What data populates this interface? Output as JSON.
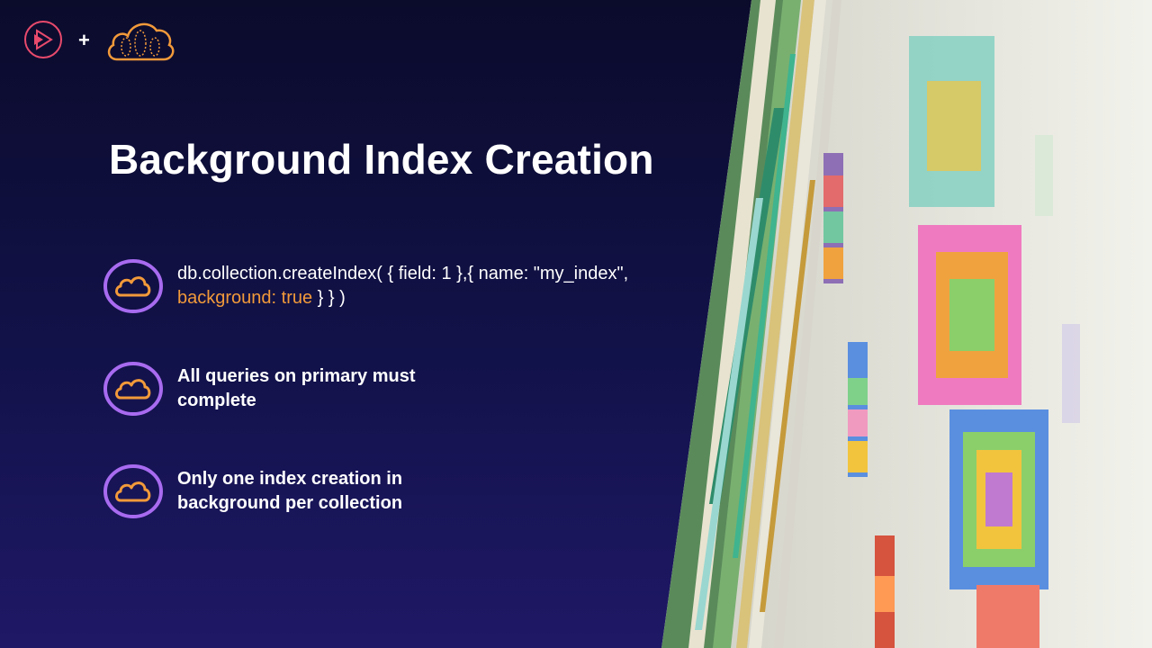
{
  "slide": {
    "title": "Background Index Creation",
    "accent_color": "#f29a3a",
    "bullet_icon_color": "#a86bf0",
    "bullets": [
      {
        "text": "db.collection.createIndex( { field: 1 },{ name: \"my_index\",",
        "highlight": "background: true",
        "suffix": " } } )"
      },
      {
        "text": "All queries on primary must complete"
      },
      {
        "text": "Only one index creation in background per collection"
      }
    ]
  },
  "logos": {
    "left": "pluralsight-play-icon",
    "separator": "+",
    "right": "cloud-icon"
  },
  "image": {
    "subject": "photo-of-color-swatch-pages"
  }
}
